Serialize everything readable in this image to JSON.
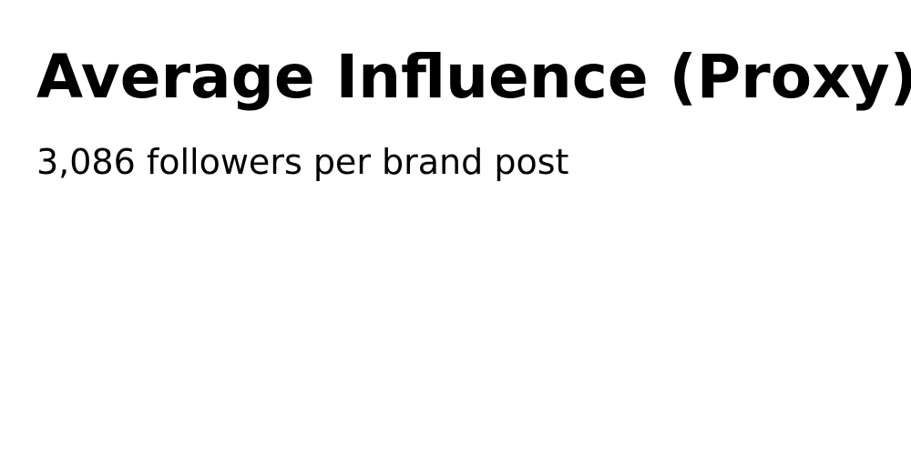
{
  "card": {
    "title": "Average Influence (Proxy)",
    "subtitle": "3,086 followers per brand post"
  }
}
